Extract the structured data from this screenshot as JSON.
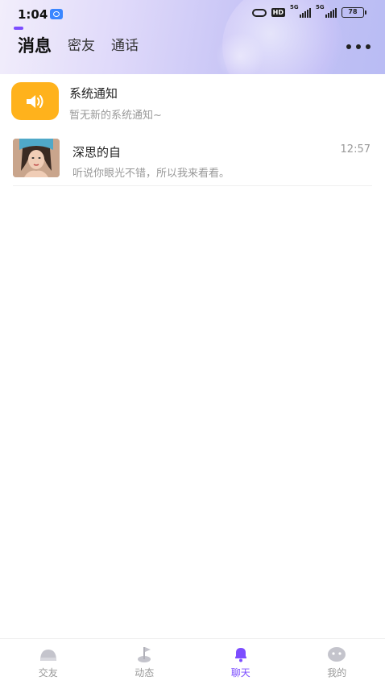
{
  "status_bar": {
    "time": "1:04",
    "hd_label": "HD",
    "network_1": "5G",
    "network_2": "5G",
    "battery": "78"
  },
  "header": {
    "tabs": [
      {
        "label": "消息",
        "active": true
      },
      {
        "label": "密友",
        "active": false
      },
      {
        "label": "通话",
        "active": false
      }
    ],
    "more_icon": "more-dots-icon"
  },
  "conversations": [
    {
      "type": "system",
      "icon": "speaker-icon",
      "title": "系统通知",
      "subtitle": "暂无新的系统通知~"
    },
    {
      "type": "chat",
      "name": "深思的自",
      "message": "听说你眼光不错，所以我来看看。",
      "time": "12:57"
    }
  ],
  "tab_bar": {
    "items": [
      {
        "label": "交友",
        "icon": "make-friends-icon",
        "active": false
      },
      {
        "label": "动态",
        "icon": "moments-icon",
        "active": false
      },
      {
        "label": "聊天",
        "icon": "chat-bell-icon",
        "active": true
      },
      {
        "label": "我的",
        "icon": "profile-icon",
        "active": false
      }
    ]
  },
  "colors": {
    "accent": "#7c4dff",
    "system_icon_bg": "#ffb21c",
    "inactive_tab": "#999999"
  }
}
